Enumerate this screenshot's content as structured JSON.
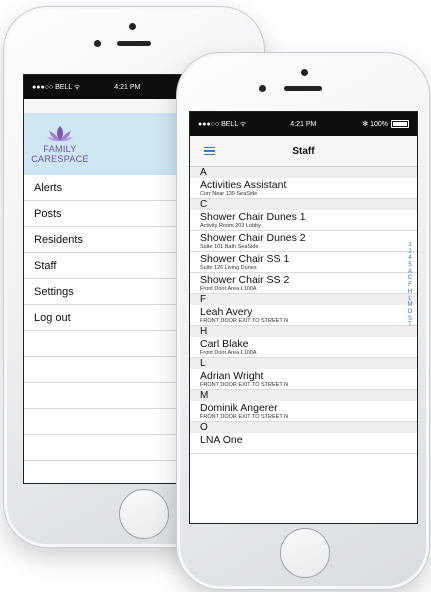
{
  "back_phone": {
    "status": {
      "carrier": "●●●○○ BELL ᯤ",
      "time": "4:21 PM"
    },
    "logo": {
      "line1": "FAMILY",
      "line2": "CARESPACE"
    },
    "menu": [
      "Alerts",
      "Posts",
      "Residents",
      "Staff",
      "Settings",
      "Log out"
    ]
  },
  "front_phone": {
    "status": {
      "carrier": "●●●○○ BELL ᯤ",
      "time": "4:21 PM",
      "battery_text": "✻ 100%"
    },
    "title": "Staff",
    "sections": [
      {
        "letter": "A",
        "rows": [
          {
            "name": "Activities Assistant",
            "sub": "Corr Near 139 SeaSide"
          }
        ]
      },
      {
        "letter": "C",
        "rows": [
          {
            "name": "Shower Chair Dunes 1",
            "sub": "Activity Room 203 Lobby"
          },
          {
            "name": "Shower Chair Dunes 2",
            "sub": "Suite 101 Bath SeaSide"
          },
          {
            "name": "Shower Chair SS 1",
            "sub": "Suite 126 Living Dunes"
          },
          {
            "name": "Shower Chair SS 2",
            "sub": "Front Door Area L100A"
          }
        ]
      },
      {
        "letter": "F",
        "rows": [
          {
            "name": "Leah Avery",
            "sub": "FRONT DOOR EXIT TO STREET N"
          }
        ]
      },
      {
        "letter": "H",
        "rows": [
          {
            "name": "Carl Blake",
            "sub": "Front Door Area L100A"
          }
        ]
      },
      {
        "letter": "L",
        "rows": [
          {
            "name": "Adrian Wright",
            "sub": "FRONT DOOR EXIT TO STREET N"
          }
        ]
      },
      {
        "letter": "M",
        "rows": [
          {
            "name": "Dominik Angerer",
            "sub": "FRONT DOOR EXIT TO STREET N"
          }
        ]
      },
      {
        "letter": "O",
        "rows": [
          {
            "name": "LNA One",
            "sub": ""
          }
        ]
      }
    ],
    "index": [
      "1",
      "2",
      "4",
      "5",
      "A",
      "C",
      "F",
      "H",
      "L",
      "M",
      "O",
      "S",
      "T"
    ]
  },
  "colors": {
    "accent": "#2a7be0",
    "logo_bg": "#cfe6f3",
    "logo_text": "#6b4fa0"
  }
}
